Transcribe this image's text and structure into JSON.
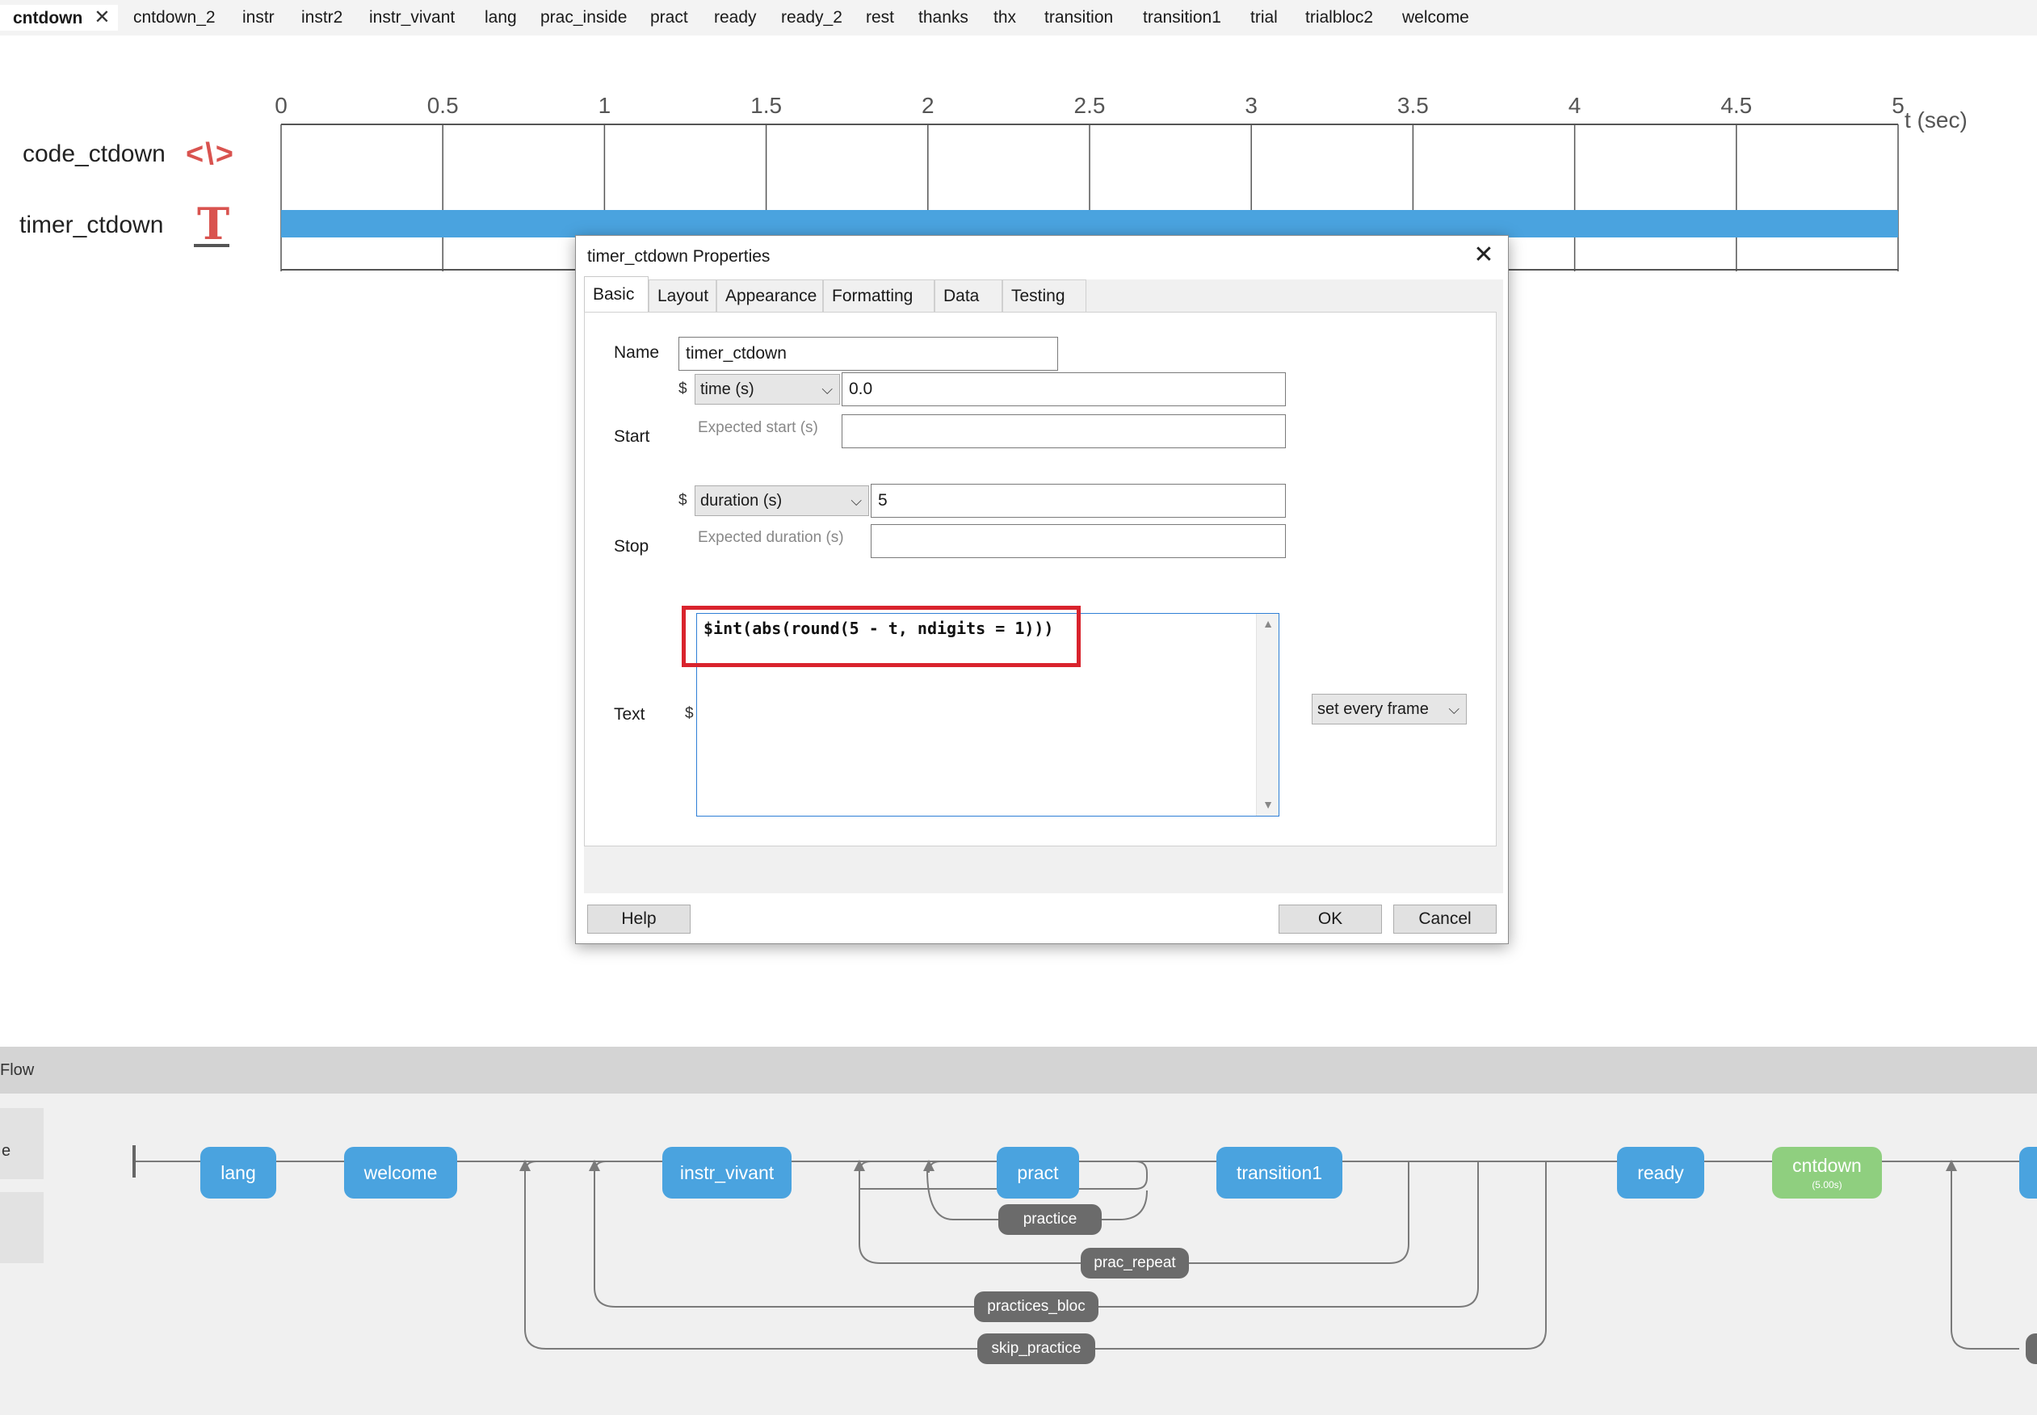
{
  "routine_tabs": [
    {
      "label": "cntdown",
      "active": true
    },
    {
      "label": "cntdown_2"
    },
    {
      "label": "instr"
    },
    {
      "label": "instr2"
    },
    {
      "label": "instr_vivant"
    },
    {
      "label": "lang"
    },
    {
      "label": "prac_inside"
    },
    {
      "label": "pract"
    },
    {
      "label": "ready"
    },
    {
      "label": "ready_2"
    },
    {
      "label": "rest"
    },
    {
      "label": "thanks"
    },
    {
      "label": "thx"
    },
    {
      "label": "transition"
    },
    {
      "label": "transition1"
    },
    {
      "label": "trial"
    },
    {
      "label": "trialbloc2"
    },
    {
      "label": "welcome"
    }
  ],
  "timeline": {
    "ticks": [
      "0",
      "0.5",
      "1",
      "1.5",
      "2",
      "2.5",
      "3",
      "3.5",
      "4",
      "4.5",
      "5"
    ],
    "tick_values": [
      0,
      0.5,
      1,
      1.5,
      2,
      2.5,
      3,
      3.5,
      4,
      4.5,
      5
    ],
    "axis_label": "t (sec)",
    "bar_color": "#4aa3df",
    "components": [
      {
        "name": "code_ctdown",
        "icon": "code-icon",
        "glyph": "<\\>"
      },
      {
        "name": "timer_ctdown",
        "icon": "text-icon",
        "glyph": "T",
        "start": 0,
        "stop": 5
      }
    ]
  },
  "dialog": {
    "title": "timer_ctdown Properties",
    "tabs": [
      "Basic",
      "Layout",
      "Appearance",
      "Formatting",
      "Data",
      "Testing"
    ],
    "active_tab": "Basic",
    "fields": {
      "name_label": "Name",
      "name_value": "timer_ctdown",
      "start_label": "Start",
      "start_type": "time (s)",
      "start_value": "0.0",
      "expected_start_label": "Expected start (s)",
      "expected_start_value": "",
      "stop_label": "Stop",
      "stop_type": "duration (s)",
      "stop_value": "5",
      "expected_duration_label": "Expected duration (s)",
      "expected_duration_value": "",
      "text_label": "Text",
      "text_value": "$int(abs(round(5 - t, ndigits = 1)))",
      "text_update": "set every frame",
      "dollar": "$"
    },
    "buttons": {
      "help": "Help",
      "ok": "OK",
      "cancel": "Cancel"
    },
    "highlight_color": "#d9232d"
  },
  "flow": {
    "title": "Flow",
    "side_label": "e",
    "routines": [
      {
        "label": "lang"
      },
      {
        "label": "welcome"
      },
      {
        "label": "instr_vivant"
      },
      {
        "label": "pract"
      },
      {
        "label": "transition1"
      },
      {
        "label": "ready"
      },
      {
        "label": "cntdown",
        "sub": "(5.00s)",
        "color": "#8fcf7f"
      }
    ],
    "loops": [
      {
        "label": "practice"
      },
      {
        "label": "prac_repeat"
      },
      {
        "label": "practices_bloc"
      },
      {
        "label": "skip_practice"
      }
    ],
    "routine_color": "#4aa3df",
    "loop_color": "#6b6b6b"
  }
}
